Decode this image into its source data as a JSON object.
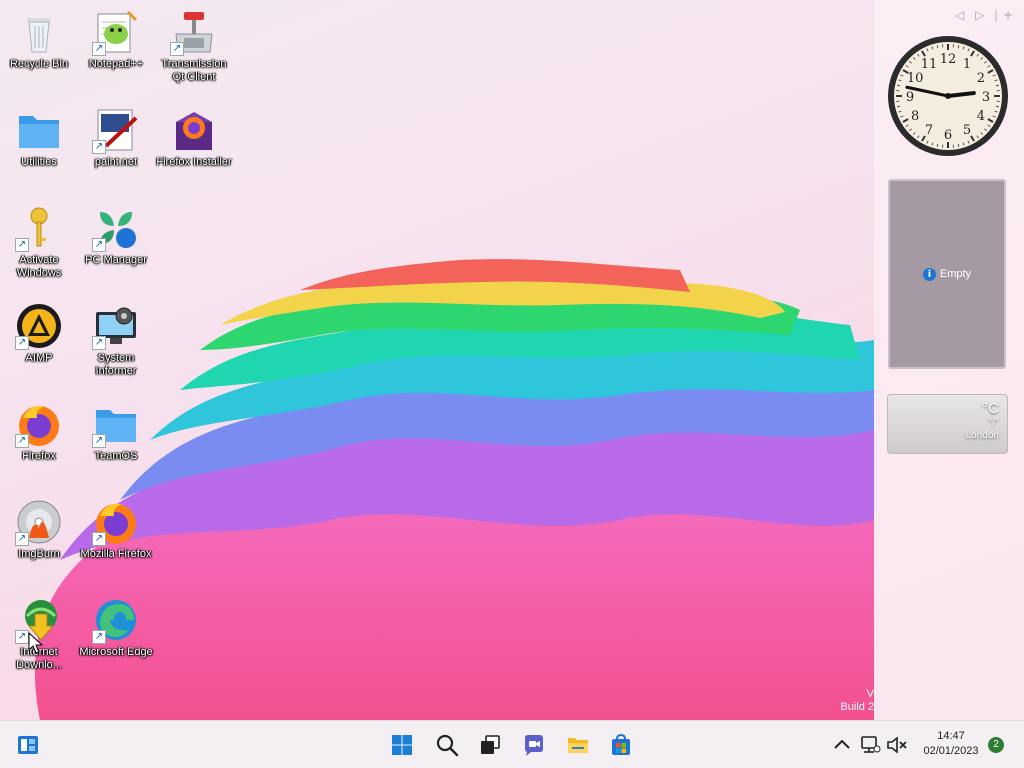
{
  "desktop": {
    "icons": [
      {
        "label": "Recycle Bin",
        "icon": "recycle-bin-icon"
      },
      {
        "label": "Notepad++",
        "icon": "notepad-plus-plus-icon"
      },
      {
        "label": "Transmission Qt Client",
        "icon": "transmission-icon"
      },
      {
        "label": "Utilities",
        "icon": "folder-icon"
      },
      {
        "label": "paint.net",
        "icon": "paint-net-icon"
      },
      {
        "label": "Firefox Installer",
        "icon": "firefox-installer-icon"
      },
      {
        "label": "Activate Windows",
        "icon": "key-icon"
      },
      {
        "label": "PC Manager",
        "icon": "pc-manager-icon"
      },
      {
        "label": "AIMP",
        "icon": "aimp-icon"
      },
      {
        "label": "System Informer",
        "icon": "system-informer-icon"
      },
      {
        "label": "Firefox",
        "icon": "firefox-icon"
      },
      {
        "label": "TeamOS",
        "icon": "folder-icon"
      },
      {
        "label": "ImgBurn",
        "icon": "imgburn-icon"
      },
      {
        "label": "Mozilla Firefox",
        "icon": "firefox-icon"
      },
      {
        "label": "Internet Downlo...",
        "icon": "internet-download-manager-icon"
      },
      {
        "label": "Microsoft Edge",
        "icon": "edge-icon"
      }
    ]
  },
  "sidebar": {
    "clock": {
      "numerals": [
        "12",
        "1",
        "2",
        "3",
        "4",
        "5",
        "6",
        "7",
        "8",
        "9",
        "10",
        "11"
      ],
      "hour": 2,
      "minute": 47
    },
    "slideshow": {
      "status": "Empty"
    },
    "weather": {
      "temp": "°C",
      "range": "°/°",
      "city": "London"
    }
  },
  "watermark": {
    "line1": "V",
    "line2": "Build 2"
  },
  "taskbar": {
    "widgets": "widgets-icon",
    "pinned": [
      "start-icon",
      "search-icon",
      "task-view-icon",
      "chat-icon",
      "file-explorer-icon",
      "store-icon"
    ],
    "time": "14:47",
    "date": "02/01/2023",
    "notifications": "2"
  }
}
